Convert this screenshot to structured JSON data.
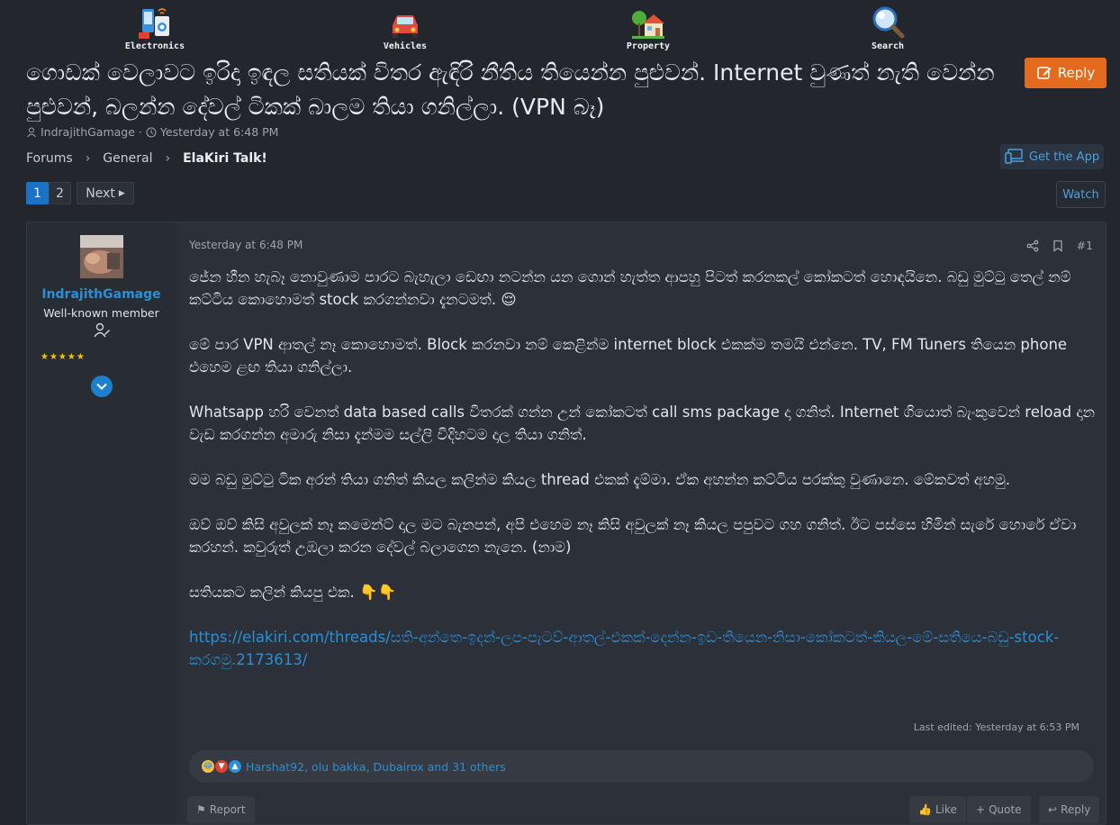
{
  "categories": [
    {
      "label": "Electronics",
      "icon": "electronics-icon"
    },
    {
      "label": "Vehicles",
      "icon": "vehicles-icon"
    },
    {
      "label": "Property",
      "icon": "property-icon"
    },
    {
      "label": "Search",
      "icon": "search-icon"
    }
  ],
  "thread": {
    "title": "ගොඩක් වෙලාවට ඉරිදා ඉඳල සතියක් විතර ඇඳිරි නීතිය තියෙන්න පුළුවන්. Internet වුණත් නැති වෙන්න පුළුවන්, බලන්න දේවල් ටිකක් බාලම තියා ගනිල්ලා. (VPN බෑ)",
    "author": "IndrajithGamage",
    "date": "Yesterday at 6:48 PM",
    "reply_label": "Reply"
  },
  "breadcrumb": [
    "Forums",
    "General",
    "ElaKiri Talk!"
  ],
  "get_app_label": "Get the App",
  "pagination": {
    "pages": [
      "1",
      "2"
    ],
    "next_label": "Next",
    "current": 1
  },
  "watch_label": "Watch",
  "post": {
    "username": "IndrajithGamage",
    "user_title": "Well-known member",
    "stars": "★★★★★",
    "date": "Yesterday at 6:48 PM",
    "number": "#1",
    "paragraphs": [
      "ජේන හීන හැබෑ නොවුණාම පාරට බැහැලා ඩෙඟා නටන්න යන ගොන් හැත්ත ආපහු පිටත් කරනකල් කෝකටත් හොඳයිනෙ. බඩු මුට්ටු තෙල් නම් කට්ටිය කොහොමත් stock කරගන්නවා දැනටමත්. 😌",
      "මේ පාර VPN ආතල් නෑ කොහොමත්. Block කරනවා නම් කෙළින්ම internet block එකක්ම තමයි එන්නෙ. TV, FM Tuners තියෙන phone එහෙම ළඟ තියා ගනිල්ලා.",
      "Whatsapp හරි වෙනත් data based calls විතරක් ගන්න උන් කෝකටත් call sms package දා ගනිත්. Internet ගියොත් බැංකුවෙන් reload දාන වැඩ කරගන්න අමාරු නිසා දැන්මම සල්ලි විදිහටම දාල තියා ගනිත්.",
      "මම බඩු මුට්ටු ටික අරන් තියා ගනිත් කියල කලින්ම කියල thread එකක් දැම්මා. ඒක අහන්න කට්ටිය පරක්කු වුණානෙ. මේකවත් අහමු.",
      "ඔව් ඔව් කිසි අවුලක් නෑ කමෙන්ට් දාල මට බැනපන්, අපි එහෙම නෑ කිසි අවුලක් නෑ කියල පපුවට ගහ ගනිත්. ඊට පස්සෙ හිමින් සැරේ හොරේ ඒවා කරහන්. කවුරුත් උඹලා කරන දේවල් බලාගෙන නැනෙ. (නාම)",
      "සතියකට කලින් කියපු එක. 👇👇"
    ],
    "link": "https://elakiri.com/threads/සති-අන්තෙ-ඉදන්-ලප-පැටව්-ආතල්-එකක්-දෙන්න-ඉඩ-තියෙන-නිසා-කෝකටත්-කියල-මේ-සතියෙ-බඩු-stock-කරගමු.2173613/",
    "last_edited": "Last edited: Yesterday at 6:53 PM",
    "reactions_text": "Harshat92, olu bakka, Dubairox and 31 others",
    "footer_buttons": {
      "report": "Report",
      "like": "Like",
      "quote": "Quote",
      "reply": "Reply"
    }
  },
  "colors": {
    "accent": "#2a8fd6",
    "reply_button": "#e46a1d",
    "page_active": "#1b72c5",
    "star": "#f2c316"
  }
}
